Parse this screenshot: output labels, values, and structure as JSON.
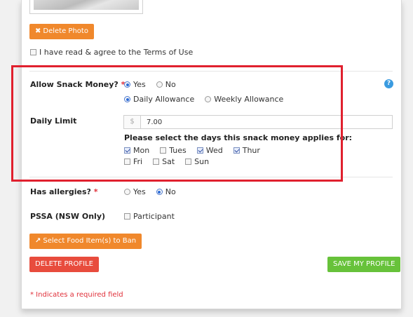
{
  "photo": {
    "delete_label": "Delete Photo"
  },
  "terms": {
    "label": "I have read & agree to the Terms of Use",
    "checked": false
  },
  "snack": {
    "label": "Allow Snack Money?",
    "required_mark": "*",
    "yes_label": "Yes",
    "no_label": "No",
    "selected": "Yes",
    "daily_label": "Daily Allowance",
    "weekly_label": "Weekly Allowance",
    "allowance_selected": "Daily Allowance"
  },
  "daily_limit": {
    "label": "Daily Limit",
    "currency": "$",
    "value": "7.00",
    "days_prompt": "Please select the days this snack money applies for:",
    "days": [
      {
        "label": "Mon",
        "checked": true
      },
      {
        "label": "Tues",
        "checked": false
      },
      {
        "label": "Wed",
        "checked": true
      },
      {
        "label": "Thur",
        "checked": true
      },
      {
        "label": "Fri",
        "checked": false
      },
      {
        "label": "Sat",
        "checked": false
      },
      {
        "label": "Sun",
        "checked": false
      }
    ]
  },
  "allergies": {
    "label": "Has allergies?",
    "required_mark": "*",
    "yes_label": "Yes",
    "no_label": "No",
    "selected": "No"
  },
  "pssa": {
    "label": "PSSA (NSW Only)",
    "option_label": "Participant",
    "checked": false
  },
  "food_ban": {
    "button_label": "Select Food Item(s) to Ban"
  },
  "actions": {
    "delete_label": "DELETE PROFILE",
    "save_label": "SAVE MY PROFILE"
  },
  "footer": {
    "required_note": "* Indicates a required field"
  },
  "help": {
    "glyph": "?"
  },
  "colors": {
    "orange": "#f0882c",
    "red": "#e84c3d",
    "green": "#67c23a",
    "highlight": "#e0202e",
    "help_blue": "#3a9be0"
  }
}
